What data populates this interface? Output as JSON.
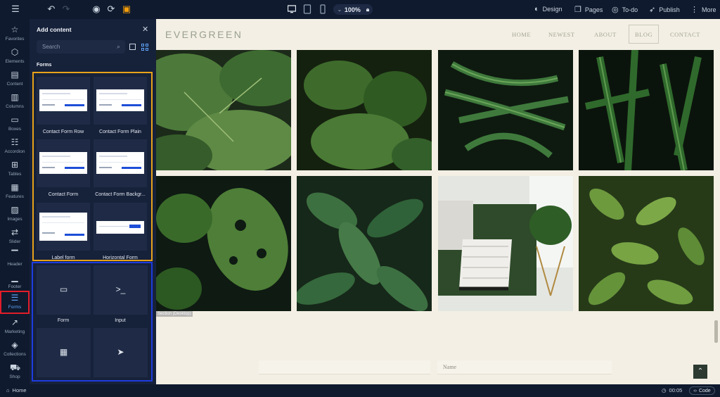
{
  "toolbar": {
    "zoom": "100%",
    "actions": [
      {
        "label": "Design",
        "icon": "palette-icon"
      },
      {
        "label": "Pages",
        "icon": "pages-icon"
      },
      {
        "label": "To-do",
        "icon": "check-circle-icon"
      },
      {
        "label": "Publish",
        "icon": "rocket-icon"
      },
      {
        "label": "More",
        "icon": "more-icon"
      }
    ]
  },
  "rail": {
    "items": [
      {
        "label": "Favorites",
        "icon": "star-icon"
      },
      {
        "label": "Elements",
        "icon": "cube-icon"
      },
      {
        "label": "Content",
        "icon": "document-icon"
      },
      {
        "label": "Columns",
        "icon": "columns-icon"
      },
      {
        "label": "Boxes",
        "icon": "box-icon"
      },
      {
        "label": "Accordion",
        "icon": "accordion-icon"
      },
      {
        "label": "Tables",
        "icon": "table-icon"
      },
      {
        "label": "Features",
        "icon": "features-icon"
      },
      {
        "label": "Images",
        "icon": "image-icon"
      },
      {
        "label": "Slider",
        "icon": "slider-icon"
      },
      {
        "label": "Header",
        "icon": "header-icon"
      },
      {
        "label": "Footer",
        "icon": "footer-icon"
      },
      {
        "label": "Forms",
        "icon": "forms-icon"
      },
      {
        "label": "Marketing",
        "icon": "trend-icon"
      },
      {
        "label": "Collections",
        "icon": "layers-icon"
      },
      {
        "label": "Shop",
        "icon": "cart-icon"
      }
    ],
    "active": "Forms"
  },
  "panel": {
    "title": "Add content",
    "search_placeholder": "Search",
    "section": "Forms",
    "templates": [
      {
        "label": "Contact Form Row"
      },
      {
        "label": "Contact Form Plain"
      },
      {
        "label": "Contact Form"
      },
      {
        "label": "Contact Form Backgr..."
      },
      {
        "label": "Label form"
      },
      {
        "label": "Horizontal Form"
      }
    ],
    "elements": [
      {
        "label": "Form",
        "icon": "form-field-icon"
      },
      {
        "label": "Input",
        "icon": "terminal-icon"
      },
      {
        "label": "",
        "icon": "calculator-icon"
      },
      {
        "label": "",
        "icon": "send-icon"
      }
    ]
  },
  "site": {
    "brand": "EVERGREEN",
    "nav": [
      "HOME",
      "NEWEST",
      "ABOUT",
      "BLOG",
      "CONTACT"
    ],
    "active_nav": "BLOG",
    "section_chip": "Section (Desktop)",
    "form_placeholder": "Name"
  },
  "footer": {
    "home": "Home",
    "time": "00:05",
    "code": "Code"
  },
  "colors": {
    "accent": "#3b82f6",
    "highlight_red": "#e11d2a",
    "highlight_orange": "#e8a219",
    "highlight_blue": "#1d3ce0"
  }
}
